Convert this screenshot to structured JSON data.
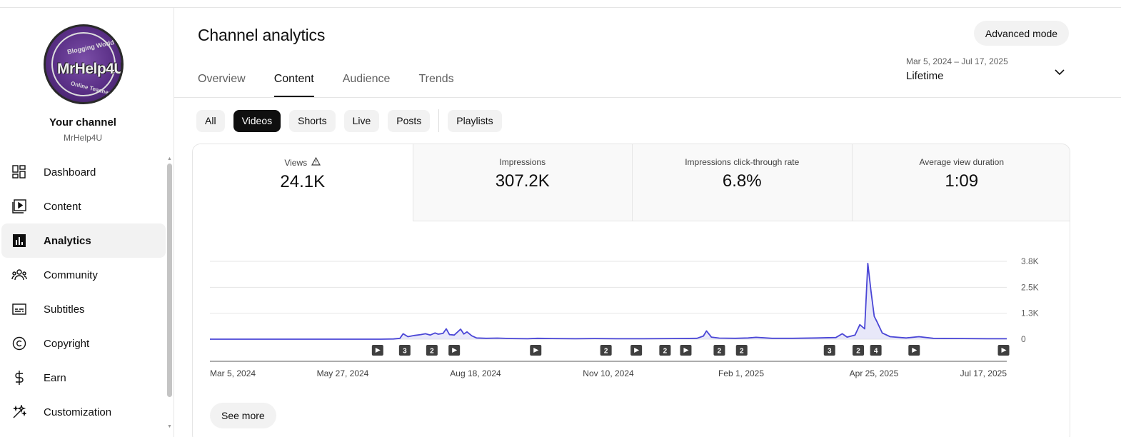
{
  "sidebar": {
    "avatar": {
      "logo_text": "MrHelp4U",
      "ring_top_text": "Blogging World",
      "ring_bottom_text": "Online Teacher"
    },
    "your_channel_label": "Your channel",
    "channel_handle": "MrHelp4U",
    "items": [
      {
        "key": "dashboard",
        "label": "Dashboard",
        "icon": "dashboard-icon"
      },
      {
        "key": "content",
        "label": "Content",
        "icon": "content-icon"
      },
      {
        "key": "analytics",
        "label": "Analytics",
        "icon": "analytics-icon",
        "active": true
      },
      {
        "key": "community",
        "label": "Community",
        "icon": "community-icon"
      },
      {
        "key": "subtitles",
        "label": "Subtitles",
        "icon": "subtitles-icon"
      },
      {
        "key": "copyright",
        "label": "Copyright",
        "icon": "copyright-icon"
      },
      {
        "key": "earn",
        "label": "Earn",
        "icon": "earn-icon"
      },
      {
        "key": "customization",
        "label": "Customization",
        "icon": "customization-icon"
      }
    ]
  },
  "header": {
    "title": "Channel analytics",
    "advanced_mode_label": "Advanced mode",
    "tabs": [
      "Overview",
      "Content",
      "Audience",
      "Trends"
    ],
    "active_tab": "Content",
    "date": {
      "range": "Mar 5, 2024 – Jul 17, 2025",
      "label": "Lifetime"
    }
  },
  "filters": {
    "chips": [
      "All",
      "Videos",
      "Shorts",
      "Live",
      "Posts"
    ],
    "extra_chip": "Playlists",
    "active": "Videos"
  },
  "metrics": [
    {
      "label": "Views",
      "value": "24.1K",
      "warning": true
    },
    {
      "label": "Impressions",
      "value": "307.2K"
    },
    {
      "label": "Impressions click-through rate",
      "value": "6.8%"
    },
    {
      "label": "Average view duration",
      "value": "1:09"
    }
  ],
  "see_more_label": "See more",
  "colors": {
    "line": "#4a46d6",
    "fill": "#d9d8f5",
    "chip_active": "#0f0f0f"
  },
  "chart_data": {
    "type": "line",
    "y_tick_labels": [
      "0",
      "1.3K",
      "2.5K",
      "3.8K"
    ],
    "y_ticks": [
      0,
      1250,
      2500,
      3750
    ],
    "ylim": [
      0,
      3750
    ],
    "x_tick_labels": [
      "Mar 5, 2024",
      "May 27, 2024",
      "Aug 18, 2024",
      "Nov 10, 2024",
      "Feb 1, 2025",
      "Apr 25, 2025",
      "Jul 17, 2025"
    ],
    "x_range": [
      "2024-03-05",
      "2025-07-17"
    ],
    "series": [
      {
        "points": [
          [
            "2024-03-05",
            0
          ],
          [
            "2024-05-01",
            0
          ],
          [
            "2024-06-20",
            0
          ],
          [
            "2024-06-28",
            10
          ],
          [
            "2024-07-02",
            40
          ],
          [
            "2024-07-04",
            260
          ],
          [
            "2024-07-07",
            120
          ],
          [
            "2024-07-11",
            180
          ],
          [
            "2024-07-15",
            220
          ],
          [
            "2024-07-18",
            260
          ],
          [
            "2024-07-21",
            200
          ],
          [
            "2024-07-24",
            300
          ],
          [
            "2024-07-26",
            240
          ],
          [
            "2024-07-29",
            280
          ],
          [
            "2024-07-31",
            500
          ],
          [
            "2024-08-02",
            220
          ],
          [
            "2024-08-05",
            200
          ],
          [
            "2024-08-09",
            480
          ],
          [
            "2024-08-11",
            250
          ],
          [
            "2024-08-13",
            350
          ],
          [
            "2024-08-16",
            160
          ],
          [
            "2024-08-19",
            60
          ],
          [
            "2024-08-25",
            40
          ],
          [
            "2024-09-01",
            50
          ],
          [
            "2024-09-10",
            30
          ],
          [
            "2024-09-20",
            20
          ],
          [
            "2024-09-26",
            40
          ],
          [
            "2024-10-05",
            30
          ],
          [
            "2024-10-20",
            20
          ],
          [
            "2024-11-01",
            30
          ],
          [
            "2024-11-15",
            20
          ],
          [
            "2024-12-01",
            20
          ],
          [
            "2024-12-20",
            30
          ],
          [
            "2025-01-04",
            40
          ],
          [
            "2025-01-08",
            150
          ],
          [
            "2025-01-10",
            400
          ],
          [
            "2025-01-13",
            100
          ],
          [
            "2025-01-18",
            50
          ],
          [
            "2025-01-28",
            40
          ],
          [
            "2025-02-05",
            60
          ],
          [
            "2025-02-10",
            90
          ],
          [
            "2025-02-20",
            40
          ],
          [
            "2025-03-05",
            40
          ],
          [
            "2025-03-20",
            60
          ],
          [
            "2025-04-01",
            80
          ],
          [
            "2025-04-05",
            260
          ],
          [
            "2025-04-08",
            100
          ],
          [
            "2025-04-13",
            200
          ],
          [
            "2025-04-16",
            700
          ],
          [
            "2025-04-19",
            500
          ],
          [
            "2025-04-21",
            3650
          ],
          [
            "2025-04-23",
            2300
          ],
          [
            "2025-04-25",
            1100
          ],
          [
            "2025-04-27",
            800
          ],
          [
            "2025-04-30",
            300
          ],
          [
            "2025-05-05",
            120
          ],
          [
            "2025-05-15",
            60
          ],
          [
            "2025-05-23",
            120
          ],
          [
            "2025-06-01",
            40
          ],
          [
            "2025-06-20",
            30
          ],
          [
            "2025-07-05",
            20
          ],
          [
            "2025-07-17",
            20
          ]
        ]
      }
    ],
    "markers": [
      {
        "date": "2024-06-18",
        "label": ""
      },
      {
        "date": "2024-07-05",
        "label": "3"
      },
      {
        "date": "2024-07-22",
        "label": "2"
      },
      {
        "date": "2024-08-05",
        "label": ""
      },
      {
        "date": "2024-09-25",
        "label": ""
      },
      {
        "date": "2024-11-08",
        "label": "2"
      },
      {
        "date": "2024-11-27",
        "label": ""
      },
      {
        "date": "2024-12-15",
        "label": "2"
      },
      {
        "date": "2024-12-28",
        "label": ""
      },
      {
        "date": "2025-01-18",
        "label": "2"
      },
      {
        "date": "2025-02-01",
        "label": "2"
      },
      {
        "date": "2025-03-28",
        "label": "3"
      },
      {
        "date": "2025-04-15",
        "label": "2"
      },
      {
        "date": "2025-04-26",
        "label": "4"
      },
      {
        "date": "2025-05-20",
        "label": ""
      },
      {
        "date": "2025-07-15",
        "label": ""
      }
    ]
  }
}
